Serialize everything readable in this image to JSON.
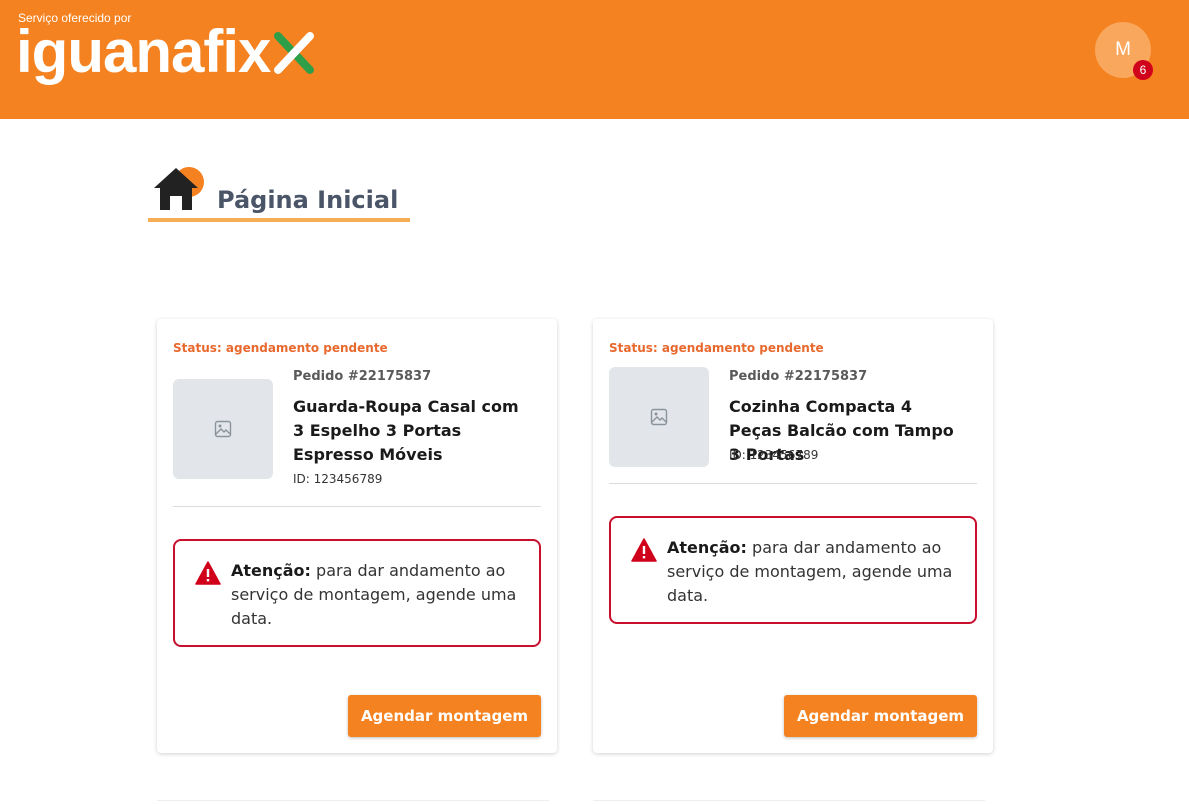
{
  "header": {
    "service_text": "Serviço oferecido por",
    "logo_text": "iguanafix",
    "avatar_initial": "M",
    "notification_count": "6",
    "colors": {
      "header_bg": "#f58220",
      "logo_x_green": "#2e9e48",
      "badge": "#d0021b"
    }
  },
  "page": {
    "title": "Página Inicial",
    "title_icon": "home-icon"
  },
  "cards": [
    {
      "status": "Status: agendamento pendente",
      "order": "Pedido #22175837",
      "product_name": "Guarda-Roupa Casal com 3 Espelho 3 Portas Espresso Móveis",
      "product_id": "ID: 123456789",
      "alert_label": "Atenção:",
      "alert_text": " para dar andamento ao serviço de montagem, agende uma data.",
      "button_label": "Agendar montagem"
    },
    {
      "status": "Status: agendamento pendente",
      "order": "Pedido #22175837",
      "product_name": "Cozinha Compacta 4 Peças Balcão com Tampo 3 Portas",
      "product_id": "ID: 123456789",
      "alert_label": "Atenção:",
      "alert_text": " para dar andamento ao serviço de montagem, agende uma data.",
      "button_label": "Agendar montagem"
    }
  ]
}
